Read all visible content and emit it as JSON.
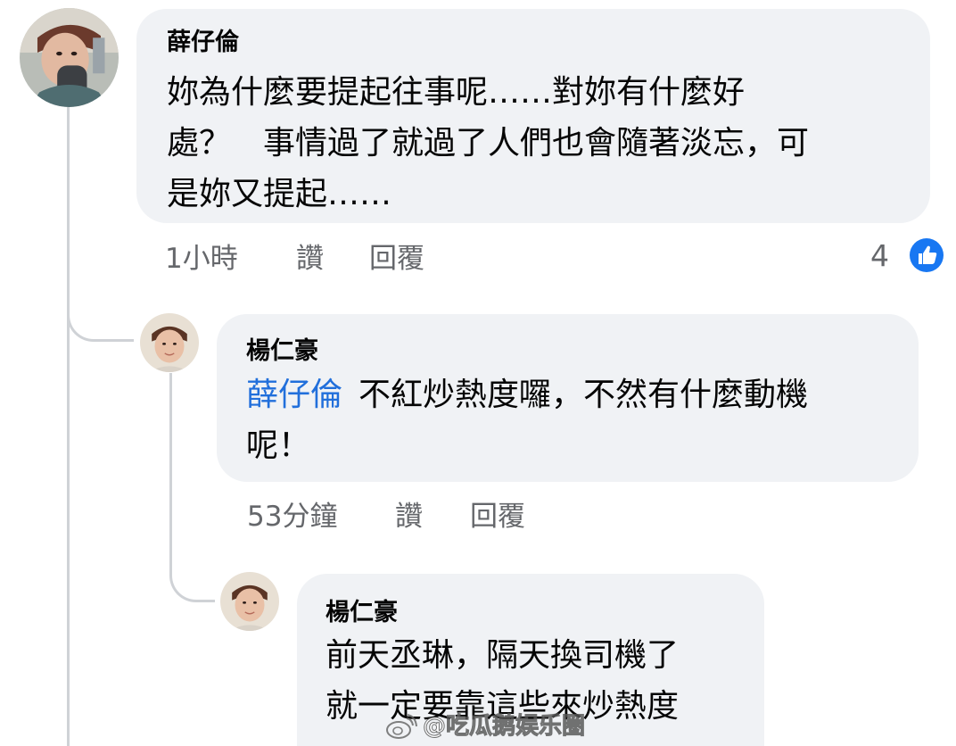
{
  "comments": [
    {
      "author": "薛仔倫",
      "text_lines": [
        "妳為什麼要提起往事呢……對妳有什麼好",
        "處？　事情過了就過了人們也會隨著淡忘，可",
        "是妳又提起……"
      ],
      "time": "1小時",
      "like_label": "讚",
      "reply_label": "回覆",
      "reaction_count": "4"
    },
    {
      "author": "楊仁豪",
      "mention": "薛仔倫",
      "text_line1": "不紅炒熱度囉，不然有什麼動機",
      "text_line2": "呢！",
      "time": "53分鐘",
      "like_label": "讚",
      "reply_label": "回覆"
    },
    {
      "author": "楊仁豪",
      "text_lines": [
        "前天丞琳，隔天換司機了",
        "就一定要靠這些來炒熱度"
      ]
    }
  ],
  "watermark": {
    "text": "@吃瓜鹅娱乐圈",
    "icon": "weibo-logo-icon"
  },
  "colors": {
    "bubble": "#f0f2f5",
    "mention": "#216fdb",
    "meta_text": "#65676b",
    "like_icon": "#1877f2"
  }
}
